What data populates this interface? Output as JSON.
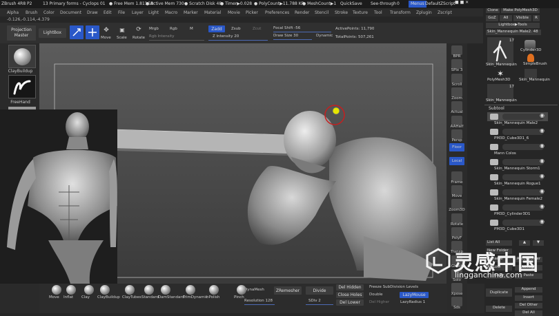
{
  "titlebar": {
    "app": "ZBrush 4R8 P2",
    "project": "13 Primary forms - Cyclops 01",
    "free_mem": "● Free Mem 1.811GB",
    "active_mem": "● Active Mem 730",
    "scratch_disk": "● Scratch Disk 48",
    "timer": "● Timer▶0.028",
    "polycount": "● PolyCount▶11.788 KP",
    "meshcount": "● MeshCount▶1",
    "quicksave": "QuickSave",
    "see_through": "See-through",
    "see_through_value": "0",
    "menus": "Menus",
    "default_script": "DefaultZScript"
  },
  "menubar": [
    "Alpha",
    "Brush",
    "Color",
    "Document",
    "Draw",
    "Edit",
    "File",
    "Layer",
    "Light",
    "Macro",
    "Marker",
    "Material",
    "Movie",
    "Picker",
    "Preferences",
    "Render",
    "Stencil",
    "Stroke",
    "Texture",
    "Tool",
    "Transform",
    "Zplugin",
    "Zscript"
  ],
  "coords": "-0.126,-0.114,-4.379",
  "toolbar": {
    "projection_master": "Projection Master",
    "lightbox": "LightBox",
    "edit": "Edit",
    "draw": "Draw",
    "move": "Move",
    "scale": "Scale",
    "rotate": "Rotate",
    "mrgb": "Mrgb",
    "rgb": "Rgb",
    "m": "M",
    "zadd": "Zadd",
    "zsub": "Zsub",
    "zcut": "Zcut",
    "rgb_intensity": "Rgb Intensity",
    "z_intensity": "Z Intensity 20",
    "focal_shift": "Focal Shift -56",
    "draw_size": "Draw Size 30",
    "dynamic": "Dynamic",
    "active_points": "ActivePoints: 11,790",
    "total_points": "TotalPoints: 507,261"
  },
  "left_sidebar": {
    "brush": "ClayBuildup",
    "stroke": "FreeHand"
  },
  "right_strip": [
    "BPR",
    "SPix 3",
    "Scroll",
    "Zoom",
    "Actual",
    "AAHalf",
    "Persp",
    "Floor",
    "Local",
    "Frame",
    "Move",
    "Zoom3D",
    "Rotate",
    "PolyF",
    "Transp",
    "Ghost",
    "Solo",
    "Xpose",
    "Sds"
  ],
  "tool_panel": {
    "clone": "Clone",
    "make_polymesh": "Make PolyMesh3D",
    "goz": "GoZ",
    "all": "All",
    "visible": "Visible",
    "r": "R",
    "lightbox_tools": "Lightbox▶Tools",
    "current_tool": "Skin_Mannequin Male2. 48",
    "tool_count_a": "17",
    "tool_count_b": "17",
    "tools": [
      "Skin_Mannequin",
      "Cylinder3D",
      "SimpleBrush",
      "PolyMesh3D",
      "Skin_Mannequin",
      "Skin_Mannequin"
    ]
  },
  "subtool": {
    "header": "Subtool",
    "items": [
      "Skin_Mannequin Male2",
      "PM3D_Cube3D1_6",
      "Mann Colos",
      "Skin_Mannequin Storm1",
      "Skin_Mannequin Rogue1",
      "Skin_Mannequin Female2",
      "PM3D_Cylinder3D1",
      "PM3D_Cube3D1"
    ],
    "list_all": "List All",
    "new_folder": "New Folder",
    "rename": "Rename",
    "autoreorder": "AutoReorder",
    "all_low": "All Low",
    "all_high": "All High",
    "copy": "Copy",
    "paste": "Paste",
    "duplicate": "Duplicate",
    "append": "Append",
    "insert": "Insert",
    "delete": "Delete",
    "del_other": "Del Other",
    "del_all": "Del All"
  },
  "bottom_brushes": [
    "Move",
    "Inflat",
    "Clay",
    "ClayBuildup",
    "ClayTubes",
    "Standard",
    "DamStandard",
    "TrimDynamic",
    "hPolish",
    "Pinch"
  ],
  "bottom_controls": {
    "dynamesh": "DynaMesh",
    "resolution": "Resolution 128",
    "zremesher": "ZRemesher",
    "divide": "Divide",
    "sdiv": "SDiv 2",
    "del_hidden": "Del Hidden",
    "close_holes": "Close Holes",
    "del_lower": "Del Lower",
    "del_higher": "Del Higher",
    "freeze_subdiv": "Freeze SubDivision Levels",
    "double": "Double",
    "lazy_mouse": "LazyMouse",
    "lazy_radius": "LazyRadius 1"
  },
  "watermark": {
    "cn": "灵感中国",
    "url": "lingganchina.com"
  },
  "colors": {
    "accent_blue": "#2a58c8",
    "cursor_yellow": "#e6e600",
    "cursor_red": "#c81e1e"
  }
}
